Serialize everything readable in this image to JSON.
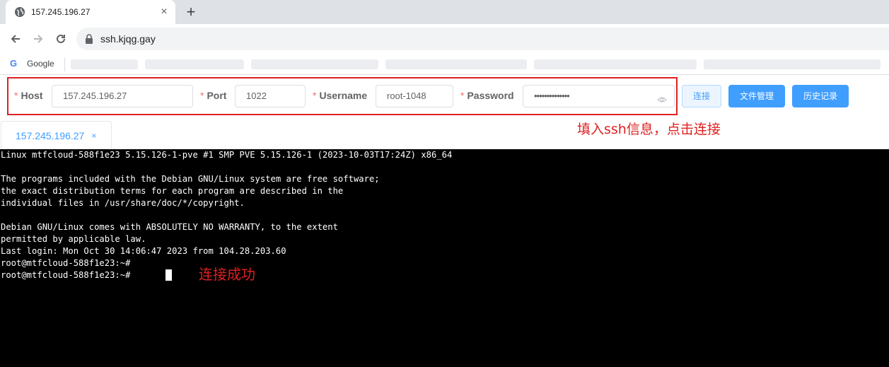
{
  "browser": {
    "tab_title": "157.245.196.27",
    "url": "ssh.kjqg.gay",
    "bookmark_label": "Google"
  },
  "form": {
    "host_label": "Host",
    "host_value": "157.245.196.27",
    "port_label": "Port",
    "port_value": "1022",
    "username_label": "Username",
    "username_value": "root-1048",
    "password_label": "Password",
    "password_value": "••••••••••••••",
    "required_mark": "*",
    "connect_label": "连接",
    "files_label": "文件管理",
    "history_label": "历史记录"
  },
  "annotations": {
    "fill_hint": "填入ssh信息，点击连接",
    "success": "连接成功"
  },
  "session_tab": {
    "label": "157.245.196.27",
    "close": "×"
  },
  "terminal": {
    "lines": [
      "Linux mtfcloud-588f1e23 5.15.126-1-pve #1 SMP PVE 5.15.126-1 (2023-10-03T17:24Z) x86_64",
      "",
      "The programs included with the Debian GNU/Linux system are free software;",
      "the exact distribution terms for each program are described in the",
      "individual files in /usr/share/doc/*/copyright.",
      "",
      "Debian GNU/Linux comes with ABSOLUTELY NO WARRANTY, to the extent",
      "permitted by applicable law.",
      "Last login: Mon Oct 30 14:06:47 2023 from 104.28.203.60",
      "root@mtfcloud-588f1e23:~#",
      "root@mtfcloud-588f1e23:~#"
    ]
  },
  "colors": {
    "annotation_red": "#e02020",
    "primary_blue": "#409eff",
    "terminal_bg": "#000000"
  }
}
